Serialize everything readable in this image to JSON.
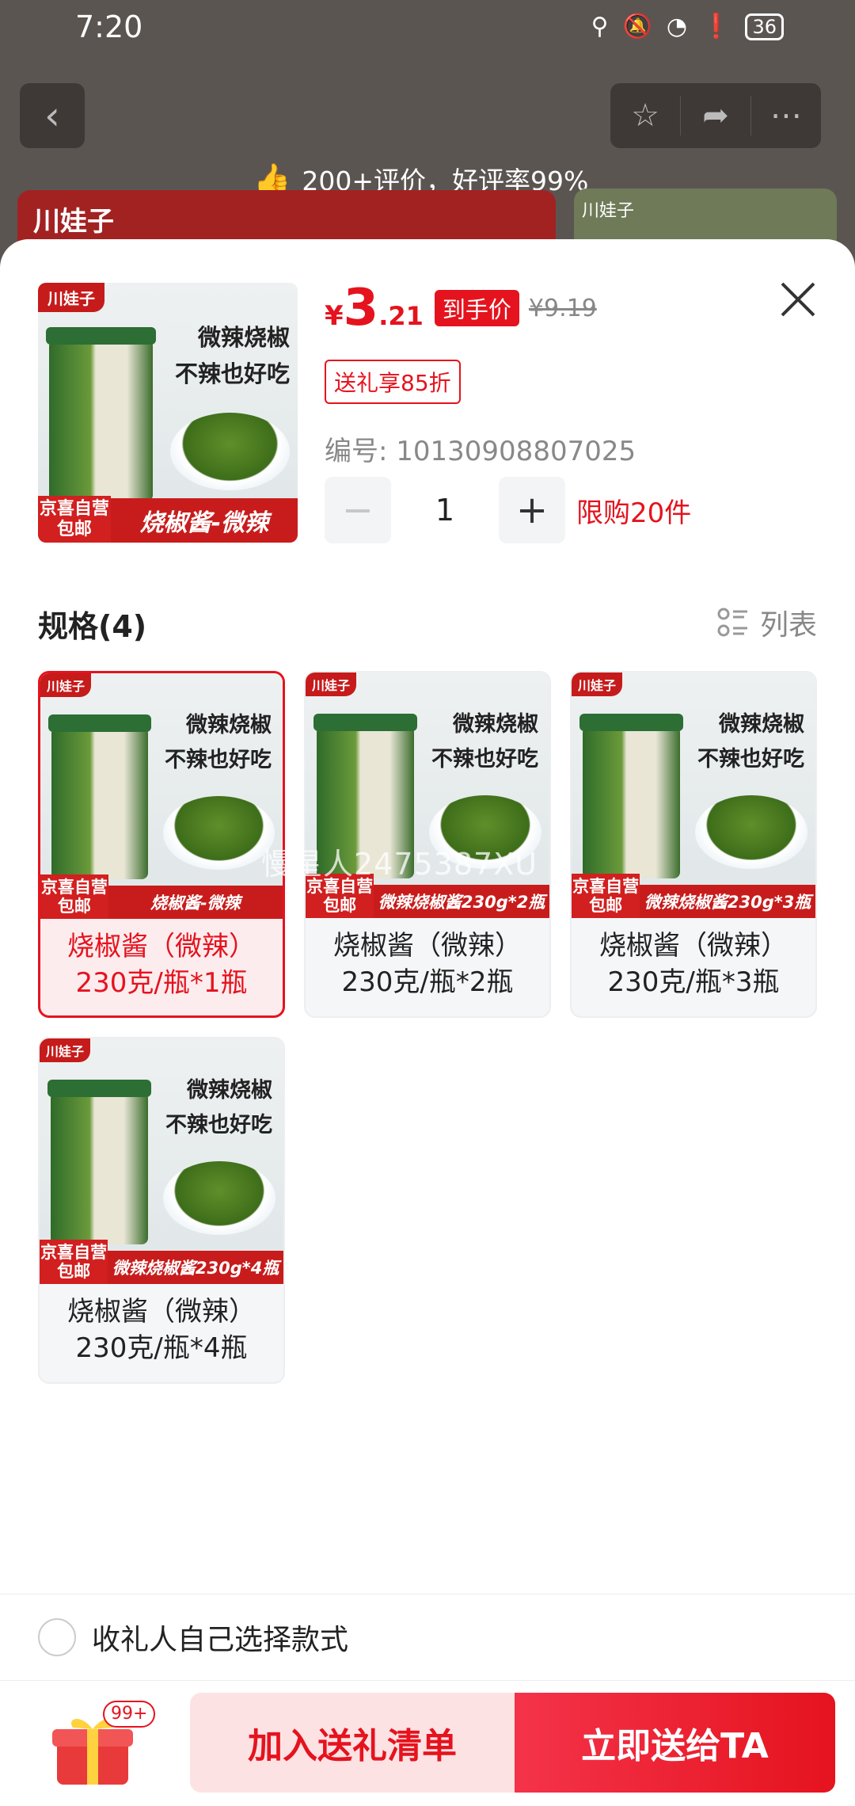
{
  "status_bar": {
    "time": "7:20",
    "battery": "36"
  },
  "background": {
    "review_text": "200+评价，好评率99%",
    "brand_logo": "川娃子",
    "brand_logo_small": "川娃子"
  },
  "product": {
    "brand": "川娃子",
    "slogan_line1": "微辣烧椒",
    "slogan_line2": "不辣也好吃",
    "jd_tag_line1": "京喜自营",
    "jd_tag_line2": "包邮",
    "image_title": "烧椒酱-微辣",
    "price_symbol": "¥",
    "price_integer": "3",
    "price_decimal": ".21",
    "price_tag": "到手价",
    "original_price": "¥9.19",
    "coupon": "送礼享85折",
    "sku_number": "编号: 10130908807025",
    "quantity": "1",
    "purchase_limit": "限购20件"
  },
  "specs": {
    "title": "规格(4)",
    "view_toggle": "列表",
    "items": [
      {
        "image_title": "烧椒酱-微辣",
        "label_line1": "烧椒酱（微辣）",
        "label_line2": "230克/瓶*1瓶"
      },
      {
        "image_title": "微辣烧椒酱230g*2瓶",
        "label_line1": "烧椒酱（微辣）",
        "label_line2": "230克/瓶*2瓶"
      },
      {
        "image_title": "微辣烧椒酱230g*3瓶",
        "label_line1": "烧椒酱（微辣）",
        "label_line2": "230克/瓶*3瓶"
      },
      {
        "image_title": "微辣烧椒酱230g*4瓶",
        "label_line1": "烧椒酱（微辣）",
        "label_line2": "230克/瓶*4瓶"
      }
    ]
  },
  "watermark": "慢星人2475387XU",
  "gift_option": {
    "label": "收礼人自己选择款式"
  },
  "bottom": {
    "badge": "99+",
    "add_button": "加入送礼清单",
    "send_button": "立即送给TA"
  },
  "colors": {
    "accent": "#e5131e",
    "accent_light": "#fde2e4"
  }
}
